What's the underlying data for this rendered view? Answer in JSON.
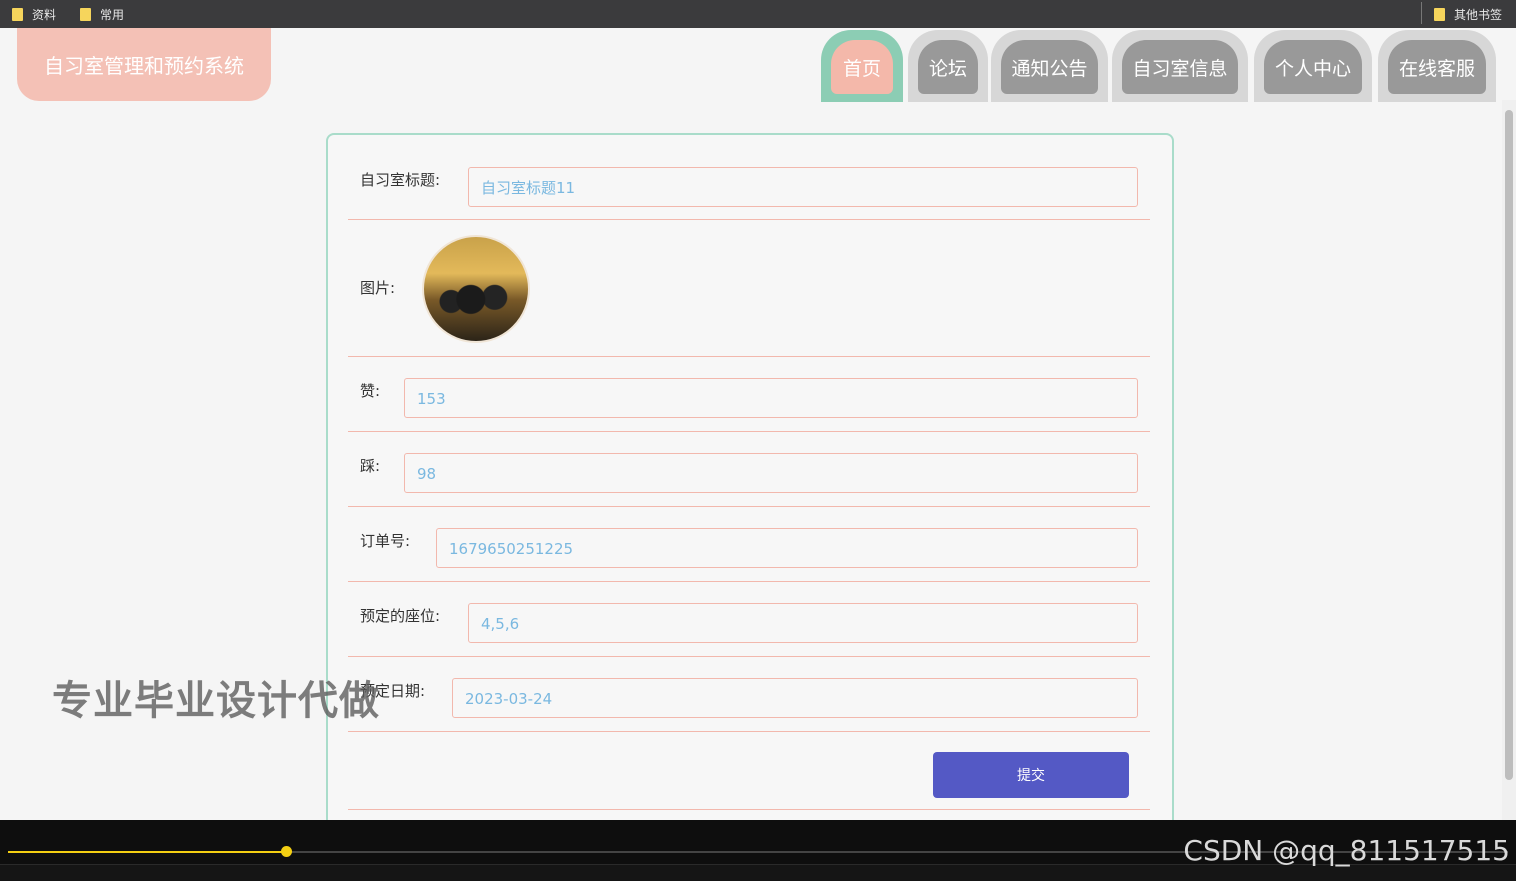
{
  "bookmarks": {
    "items": [
      "资料",
      "常用"
    ],
    "other": "其他书签"
  },
  "header": {
    "logo": "自习室管理和预约系统",
    "nav": [
      "首页",
      "论坛",
      "通知公告",
      "自习室信息",
      "个人中心",
      "在线客服"
    ]
  },
  "form": {
    "title_label": "自习室标题:",
    "title_value": "自习室标题11",
    "image_label": "图片:",
    "likes_label": "赞:",
    "likes_value": "153",
    "dislikes_label": "踩:",
    "dislikes_value": "98",
    "order_label": "订单号:",
    "order_value": "1679650251225",
    "seats_label": "预定的座位:",
    "seats_value": "4,5,6",
    "date_label": "预定日期:",
    "date_value": "2023-03-24",
    "submit": "提交"
  },
  "overlay": {
    "watermark": "专业毕业设计代做",
    "csdn": "CSDN @qq_811517515"
  },
  "player": {
    "progress": 0.185
  },
  "colors": {
    "accent_button": "#5459c5",
    "input_border": "#f2b8ad",
    "card_border": "#a9dcca",
    "logo_bg": "#f4c1b6"
  }
}
